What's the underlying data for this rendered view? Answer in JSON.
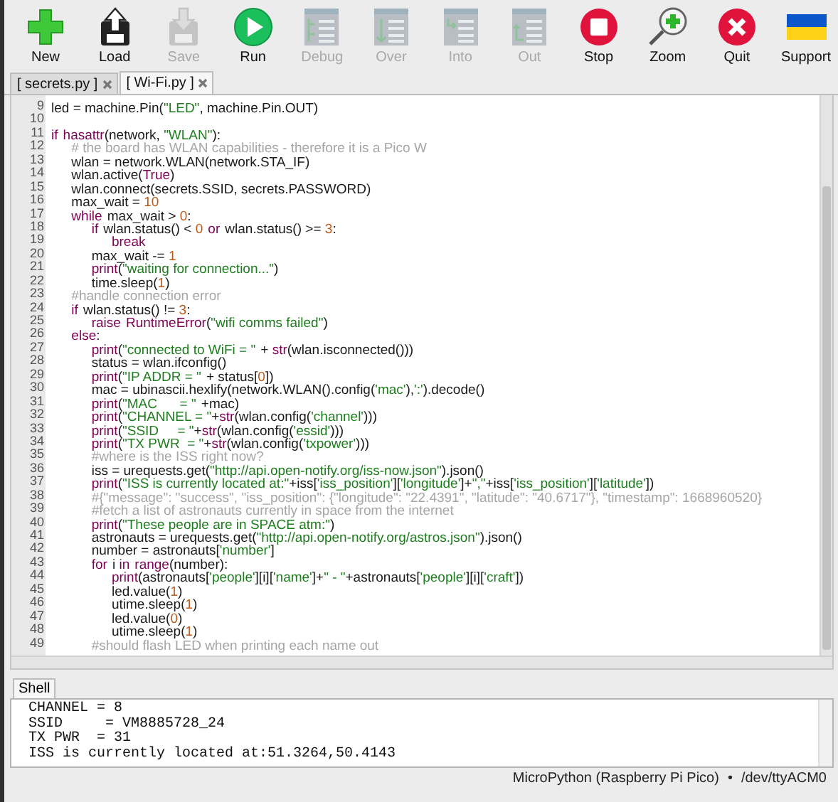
{
  "toolbar": [
    {
      "label": "New",
      "kind": "new",
      "disabled": false
    },
    {
      "label": "Load",
      "kind": "load",
      "disabled": false
    },
    {
      "label": "Save",
      "kind": "save",
      "disabled": true
    },
    {
      "label": "Run",
      "kind": "run",
      "disabled": false
    },
    {
      "label": "Debug",
      "kind": "debug",
      "disabled": true
    },
    {
      "label": "Over",
      "kind": "over",
      "disabled": true
    },
    {
      "label": "Into",
      "kind": "into",
      "disabled": true
    },
    {
      "label": "Out",
      "kind": "out",
      "disabled": true
    },
    {
      "label": "Stop",
      "kind": "stop",
      "disabled": false
    },
    {
      "label": "Zoom",
      "kind": "zoom",
      "disabled": false
    },
    {
      "label": "Quit",
      "kind": "quit",
      "disabled": false
    },
    {
      "label": "Support",
      "kind": "flag",
      "disabled": false
    }
  ],
  "tabs": [
    {
      "label": "[ secrets.py ]",
      "selected": false
    },
    {
      "label": "[ Wi-Fi.py ]",
      "selected": true
    }
  ],
  "editor": {
    "lines": [
      {
        "number": "9",
        "tokens": [
          {
            "kind": "plain",
            "text": "led = machine.Pin("
          },
          {
            "kind": "string",
            "text": "\"LED\""
          },
          {
            "kind": "plain",
            "text": ", machine.Pin.OUT)"
          }
        ]
      },
      {
        "number": "10"
      },
      {
        "number": "11",
        "tokens": [
          {
            "kind": "keyword",
            "text": "if"
          },
          {
            "kind": "builtin",
            "text": " hasattr"
          },
          {
            "kind": "plain",
            "text": "(network, "
          },
          {
            "kind": "string",
            "text": "\"WLAN\""
          },
          {
            "kind": "plain",
            "text": "):"
          }
        ]
      },
      {
        "number": "12",
        "tokens": [
          {
            "kind": "comment",
            "text": "    # the board has WLAN capabilities - therefore it is a Pico W"
          }
        ]
      },
      {
        "number": "13",
        "tokens": [
          {
            "kind": "plain",
            "text": "    wlan = network.WLAN(network.STA_IF)"
          }
        ]
      },
      {
        "number": "14",
        "tokens": [
          {
            "kind": "plain",
            "text": "    wlan.active("
          },
          {
            "kind": "keyword",
            "text": "True"
          },
          {
            "kind": "plain",
            "text": ")"
          }
        ]
      },
      {
        "number": "15",
        "tokens": [
          {
            "kind": "plain",
            "text": "    wlan.connect(secrets.SSID, secrets.PASSWORD)"
          }
        ]
      },
      {
        "number": "16",
        "tokens": [
          {
            "kind": "plain",
            "text": "    max_wait = "
          },
          {
            "kind": "number",
            "text": "10"
          }
        ]
      },
      {
        "number": "17",
        "tokens": [
          {
            "kind": "keyword",
            "text": "    while"
          },
          {
            "kind": "plain",
            "text": " max_wait > "
          },
          {
            "kind": "number",
            "text": "0"
          },
          {
            "kind": "plain",
            "text": ":"
          }
        ]
      },
      {
        "number": "18",
        "tokens": [
          {
            "kind": "keyword",
            "text": "        if"
          },
          {
            "kind": "plain",
            "text": " wlan.status() < "
          },
          {
            "kind": "number",
            "text": "0"
          },
          {
            "kind": "keyword",
            "text": " or"
          },
          {
            "kind": "plain",
            "text": " wlan.status() >= "
          },
          {
            "kind": "number",
            "text": "3"
          },
          {
            "kind": "plain",
            "text": ":"
          }
        ]
      },
      {
        "number": "19",
        "tokens": [
          {
            "kind": "keyword",
            "text": "            break"
          }
        ]
      },
      {
        "number": "20",
        "tokens": [
          {
            "kind": "plain",
            "text": "        max_wait -= "
          },
          {
            "kind": "number",
            "text": "1"
          }
        ]
      },
      {
        "number": "21",
        "tokens": [
          {
            "kind": "builtin",
            "text": "        print"
          },
          {
            "kind": "plain",
            "text": "("
          },
          {
            "kind": "string",
            "text": "\"waiting for connection...\""
          },
          {
            "kind": "plain",
            "text": ")"
          }
        ]
      },
      {
        "number": "22",
        "tokens": [
          {
            "kind": "plain",
            "text": "        time.sleep("
          },
          {
            "kind": "number",
            "text": "1"
          },
          {
            "kind": "plain",
            "text": ")"
          }
        ]
      },
      {
        "number": "23",
        "tokens": [
          {
            "kind": "comment",
            "text": "    #handle connection error"
          }
        ]
      },
      {
        "number": "24",
        "tokens": [
          {
            "kind": "keyword",
            "text": "    if"
          },
          {
            "kind": "plain",
            "text": " wlan.status() != "
          },
          {
            "kind": "number",
            "text": "3"
          },
          {
            "kind": "plain",
            "text": ":"
          }
        ]
      },
      {
        "number": "25",
        "tokens": [
          {
            "kind": "keyword",
            "text": "        raise"
          },
          {
            "kind": "builtin",
            "text": " RuntimeError"
          },
          {
            "kind": "plain",
            "text": "("
          },
          {
            "kind": "string",
            "text": "\"wifi comms failed\""
          },
          {
            "kind": "plain",
            "text": ")"
          }
        ]
      },
      {
        "number": "26",
        "tokens": [
          {
            "kind": "keyword",
            "text": "    else"
          },
          {
            "kind": "plain",
            "text": ":"
          }
        ]
      },
      {
        "number": "27",
        "tokens": [
          {
            "kind": "builtin",
            "text": "        print"
          },
          {
            "kind": "plain",
            "text": "("
          },
          {
            "kind": "string",
            "text": "\"connected to WiFi = \""
          },
          {
            "kind": "plain",
            "text": " + "
          },
          {
            "kind": "builtin",
            "text": "str"
          },
          {
            "kind": "plain",
            "text": "(wlan.isconnected()))"
          }
        ]
      },
      {
        "number": "28",
        "tokens": [
          {
            "kind": "plain",
            "text": "        status = wlan.ifconfig()"
          }
        ]
      },
      {
        "number": "29",
        "tokens": [
          {
            "kind": "builtin",
            "text": "        print"
          },
          {
            "kind": "plain",
            "text": "("
          },
          {
            "kind": "string",
            "text": "\"IP ADDR = \""
          },
          {
            "kind": "plain",
            "text": " + status["
          },
          {
            "kind": "number",
            "text": "0"
          },
          {
            "kind": "plain",
            "text": "])"
          }
        ]
      },
      {
        "number": "30",
        "tokens": [
          {
            "kind": "plain",
            "text": "        mac = ubinascii.hexlify(network.WLAN().config("
          },
          {
            "kind": "string",
            "text": "'mac'"
          },
          {
            "kind": "plain",
            "text": "),"
          },
          {
            "kind": "string",
            "text": "':'"
          },
          {
            "kind": "plain",
            "text": ").decode()"
          }
        ]
      },
      {
        "number": "31",
        "tokens": [
          {
            "kind": "builtin",
            "text": "        print"
          },
          {
            "kind": "plain",
            "text": "("
          },
          {
            "kind": "string",
            "text": "\"MAC      = \""
          },
          {
            "kind": "plain",
            "text": " +mac)"
          }
        ]
      },
      {
        "number": "32",
        "tokens": [
          {
            "kind": "builtin",
            "text": "        print"
          },
          {
            "kind": "plain",
            "text": "("
          },
          {
            "kind": "string",
            "text": "\"CHANNEL = \""
          },
          {
            "kind": "plain",
            "text": "+"
          },
          {
            "kind": "builtin",
            "text": "str"
          },
          {
            "kind": "plain",
            "text": "(wlan.config("
          },
          {
            "kind": "string",
            "text": "'channel'"
          },
          {
            "kind": "plain",
            "text": ")))"
          }
        ]
      },
      {
        "number": "33",
        "tokens": [
          {
            "kind": "builtin",
            "text": "        print"
          },
          {
            "kind": "plain",
            "text": "("
          },
          {
            "kind": "string",
            "text": "\"SSID     = \""
          },
          {
            "kind": "plain",
            "text": "+"
          },
          {
            "kind": "builtin",
            "text": "str"
          },
          {
            "kind": "plain",
            "text": "(wlan.config("
          },
          {
            "kind": "string",
            "text": "'essid'"
          },
          {
            "kind": "plain",
            "text": ")))"
          }
        ]
      },
      {
        "number": "34",
        "tokens": [
          {
            "kind": "builtin",
            "text": "        print"
          },
          {
            "kind": "plain",
            "text": "("
          },
          {
            "kind": "string",
            "text": "\"TX PWR  = \""
          },
          {
            "kind": "plain",
            "text": "+"
          },
          {
            "kind": "builtin",
            "text": "str"
          },
          {
            "kind": "plain",
            "text": "(wlan.config("
          },
          {
            "kind": "string",
            "text": "'txpower'"
          },
          {
            "kind": "plain",
            "text": ")))"
          }
        ]
      },
      {
        "number": "35",
        "tokens": [
          {
            "kind": "comment",
            "text": "        #where is the ISS right now?"
          }
        ]
      },
      {
        "number": "36",
        "tokens": [
          {
            "kind": "plain",
            "text": "        iss = urequests.get("
          },
          {
            "kind": "string",
            "text": "\"http://api.open-notify.org/iss-now.json\""
          },
          {
            "kind": "plain",
            "text": ").json()"
          }
        ]
      },
      {
        "number": "37",
        "tokens": [
          {
            "kind": "builtin",
            "text": "        print"
          },
          {
            "kind": "plain",
            "text": "("
          },
          {
            "kind": "string",
            "text": "\"ISS is currently located at:\""
          },
          {
            "kind": "plain",
            "text": "+iss["
          },
          {
            "kind": "string",
            "text": "'iss_position'"
          },
          {
            "kind": "plain",
            "text": "]["
          },
          {
            "kind": "string",
            "text": "'longitude'"
          },
          {
            "kind": "plain",
            "text": "]+"
          },
          {
            "kind": "string",
            "text": "\",\""
          },
          {
            "kind": "plain",
            "text": "+iss["
          },
          {
            "kind": "string",
            "text": "'iss_position'"
          },
          {
            "kind": "plain",
            "text": "]["
          },
          {
            "kind": "string",
            "text": "'latitude'"
          },
          {
            "kind": "plain",
            "text": "])"
          }
        ]
      },
      {
        "number": "38",
        "tokens": [
          {
            "kind": "comment",
            "text": "        #{\"message\": \"success\", \"iss_position\": {\"longitude\": \"22.4391\", \"latitude\": \"40.6717\"}, \"timestamp\": 1668960520}"
          }
        ]
      },
      {
        "number": "39",
        "tokens": [
          {
            "kind": "comment",
            "text": "        #fetch a list of astronauts currently in space from the internet"
          }
        ]
      },
      {
        "number": "40",
        "tokens": [
          {
            "kind": "builtin",
            "text": "        print"
          },
          {
            "kind": "plain",
            "text": "("
          },
          {
            "kind": "string",
            "text": "\"These people are in SPACE atm:\""
          },
          {
            "kind": "plain",
            "text": ")"
          }
        ]
      },
      {
        "number": "41",
        "tokens": [
          {
            "kind": "plain",
            "text": "        astronauts = urequests.get("
          },
          {
            "kind": "string",
            "text": "\"http://api.open-notify.org/astros.json\""
          },
          {
            "kind": "plain",
            "text": ").json()"
          }
        ]
      },
      {
        "number": "42",
        "tokens": [
          {
            "kind": "plain",
            "text": "        number = astronauts["
          },
          {
            "kind": "string",
            "text": "'number'"
          },
          {
            "kind": "plain",
            "text": "]"
          }
        ]
      },
      {
        "number": "43",
        "tokens": [
          {
            "kind": "keyword",
            "text": "        for"
          },
          {
            "kind": "plain",
            "text": " i "
          },
          {
            "kind": "keyword",
            "text": "in"
          },
          {
            "kind": "builtin",
            "text": " range"
          },
          {
            "kind": "plain",
            "text": "(number):"
          }
        ]
      },
      {
        "number": "44",
        "tokens": [
          {
            "kind": "builtin",
            "text": "            print"
          },
          {
            "kind": "plain",
            "text": "(astronauts["
          },
          {
            "kind": "string",
            "text": "'people'"
          },
          {
            "kind": "plain",
            "text": "][i]["
          },
          {
            "kind": "string",
            "text": "'name'"
          },
          {
            "kind": "plain",
            "text": "]+"
          },
          {
            "kind": "string",
            "text": "\" - \""
          },
          {
            "kind": "plain",
            "text": "+astronauts["
          },
          {
            "kind": "string",
            "text": "'people'"
          },
          {
            "kind": "plain",
            "text": "][i]["
          },
          {
            "kind": "string",
            "text": "'craft'"
          },
          {
            "kind": "plain",
            "text": "])"
          }
        ]
      },
      {
        "number": "45",
        "tokens": [
          {
            "kind": "plain",
            "text": "            led.value("
          },
          {
            "kind": "number",
            "text": "1"
          },
          {
            "kind": "plain",
            "text": ")"
          }
        ]
      },
      {
        "number": "46",
        "tokens": [
          {
            "kind": "plain",
            "text": "            utime.sleep("
          },
          {
            "kind": "number",
            "text": "1"
          },
          {
            "kind": "plain",
            "text": ")"
          }
        ]
      },
      {
        "number": "47",
        "tokens": [
          {
            "kind": "plain",
            "text": "            led.value("
          },
          {
            "kind": "number",
            "text": "0"
          },
          {
            "kind": "plain",
            "text": ")"
          }
        ]
      },
      {
        "number": "48",
        "tokens": [
          {
            "kind": "plain",
            "text": "            utime.sleep("
          },
          {
            "kind": "number",
            "text": "1"
          },
          {
            "kind": "plain",
            "text": ")"
          }
        ]
      },
      {
        "number": "49",
        "tokens": [
          {
            "kind": "comment",
            "text": "        #should flash LED when printing each name out"
          }
        ]
      }
    ]
  },
  "shell": {
    "tab": "Shell",
    "lines": [
      "CHANNEL = 8",
      "SSID     = VM8885728_24",
      "TX PWR  = 31",
      "ISS is currently located at:51.3264,50.4143"
    ]
  },
  "status_bar": {
    "interpreter": "MicroPython (Raspberry Pi Pico)",
    "separator": "•",
    "port": "/dev/ttyACM0"
  }
}
